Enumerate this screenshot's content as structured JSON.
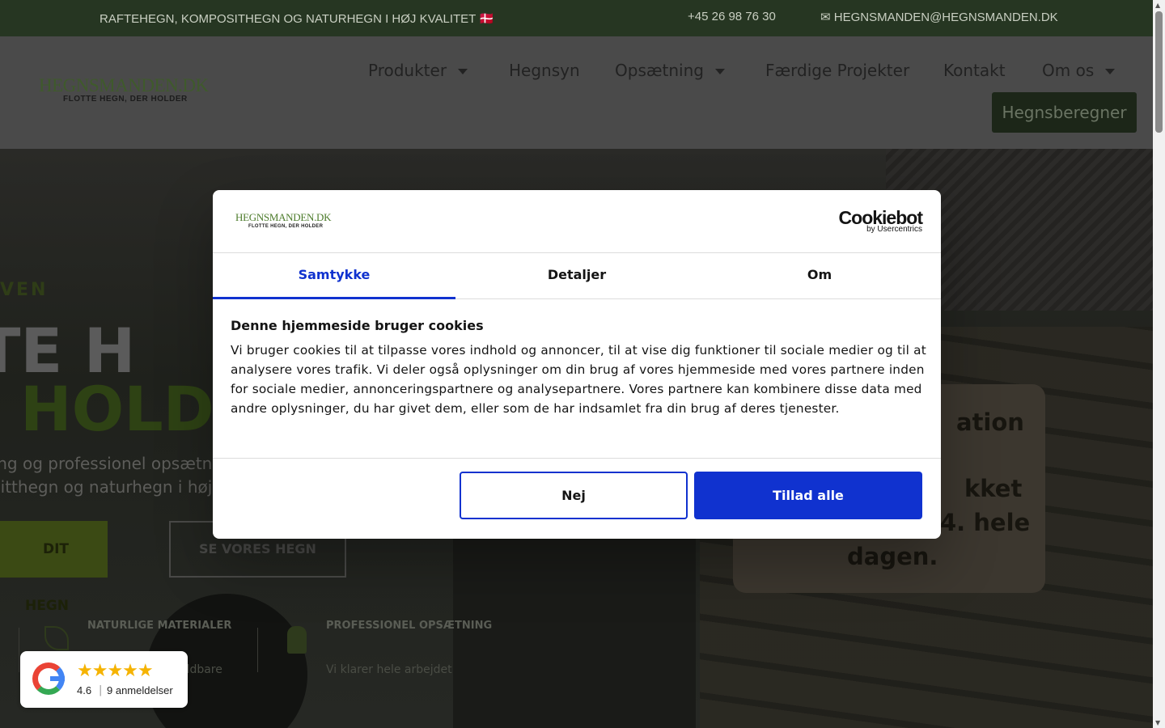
{
  "topbar": {
    "tagline": "RAFTEHEGN, KOMPOSITHEGN OG NATURHEGN I HØJ KVALITET 🇩🇰",
    "phone": " +45 26 98 76 30",
    "email": "✉ HEGNSMANDEN@HEGNSMANDEN.DK"
  },
  "header": {
    "logo_name": "HEGNSMANDEN.DK",
    "logo_sub": "FLOTTE HEGN, DER HOLDER",
    "nav": [
      "Produkter",
      "Hegnsyn",
      "Opsætning",
      "Færdige Projekter",
      "Kontakt",
      "Om os"
    ],
    "cta": "Hegnsberegner"
  },
  "hero": {
    "kicker": "VEN",
    "h1_line1": "TTE H",
    "h1_line2": "R HOLD",
    "p_line1": "ning og professionel opsætn",
    "p_line2": "ositthegn og naturhegn i høj",
    "btn_primary": "DIT HEGN",
    "btn_secondary": "SE VORES HEGN",
    "feature1_title": "NATURLIGE MATERIALER",
    "feature1_text": "oldbare",
    "feature2_title": "PROFESSIONEL OPSÆTNING",
    "feature2_text": "Vi klarer hele arbejdet",
    "card_l1": "ation",
    "card_l2": "kket",
    "card_l3": "4. hele",
    "card_l4": "dagen."
  },
  "google_badge": {
    "stars": "★★★★★",
    "rating": "4.6",
    "separator": "|",
    "count": "9 anmeldelser"
  },
  "cookie_dialog": {
    "logo_name": "HEGNSMANDEN.DK",
    "logo_sub": "FLOTTE HEGN, DER HOLDER",
    "brand": "Cookiebot",
    "brand_sub": "by Usercentrics",
    "tabs": [
      "Samtykke",
      "Detaljer",
      "Om"
    ],
    "active_tab": "Samtykke",
    "title": "Denne hjemmeside bruger cookies ",
    "text": "Vi bruger cookies til at tilpasse vores indhold og annoncer, til at vise dig funktioner til sociale medier og til at analysere vores trafik. Vi deler også oplysninger om din brug af vores hjemmeside med vores partnere inden for sociale medier, annonceringspartnere og analysepartnere. Vores partnere kan kombinere disse data med andre oplysninger, du har givet dem, eller som de har indsamlet fra din brug af deres tjenester.",
    "btn_deny": "Nej",
    "btn_allow": "Tillad alle"
  },
  "colors": {
    "accent_blue": "#1032cf",
    "brand_green": "#4d7c2c",
    "topbar_bg": "#263622"
  }
}
